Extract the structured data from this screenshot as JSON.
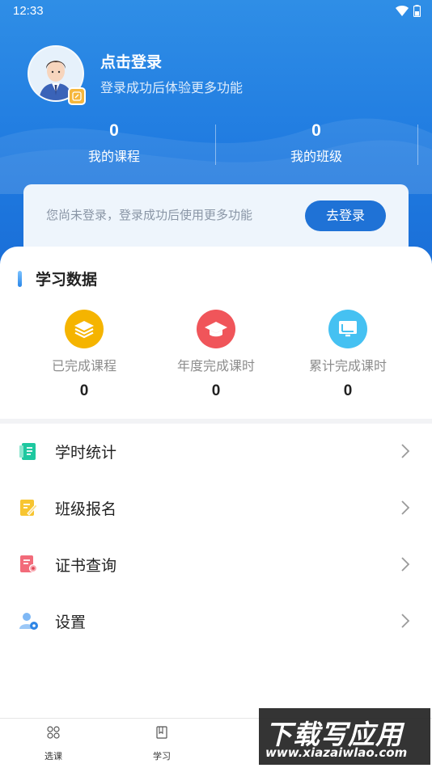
{
  "status_bar": {
    "time": "12:33"
  },
  "profile": {
    "login_title": "点击登录",
    "login_subtitle": "登录成功后体验更多功能"
  },
  "stats": [
    {
      "value": "0",
      "label": "我的课程"
    },
    {
      "value": "0",
      "label": "我的班级"
    }
  ],
  "notice": {
    "text": "您尚未登录，登录成功后使用更多功能",
    "button": "去登录"
  },
  "learning": {
    "title": "学习数据",
    "items": [
      {
        "label": "已完成课程",
        "value": "0",
        "icon": "layers-icon",
        "color": "#f5b400"
      },
      {
        "label": "年度完成课时",
        "value": "0",
        "icon": "graduation-cap-icon",
        "color": "#f0555a"
      },
      {
        "label": "累计完成课时",
        "value": "0",
        "icon": "chart-board-icon",
        "color": "#45c1f2"
      }
    ]
  },
  "menu": [
    {
      "label": "学时统计",
      "icon": "notebook-icon"
    },
    {
      "label": "班级报名",
      "icon": "edit-note-icon"
    },
    {
      "label": "证书查询",
      "icon": "certificate-icon"
    },
    {
      "label": "设置",
      "icon": "user-settings-icon"
    }
  ],
  "tabbar": [
    {
      "label": "选课",
      "icon": "grid-icon"
    },
    {
      "label": "学习",
      "icon": "book-icon"
    }
  ],
  "watermark": {
    "title": "下载写应用",
    "url": "www.xiazaiwlao.com"
  }
}
